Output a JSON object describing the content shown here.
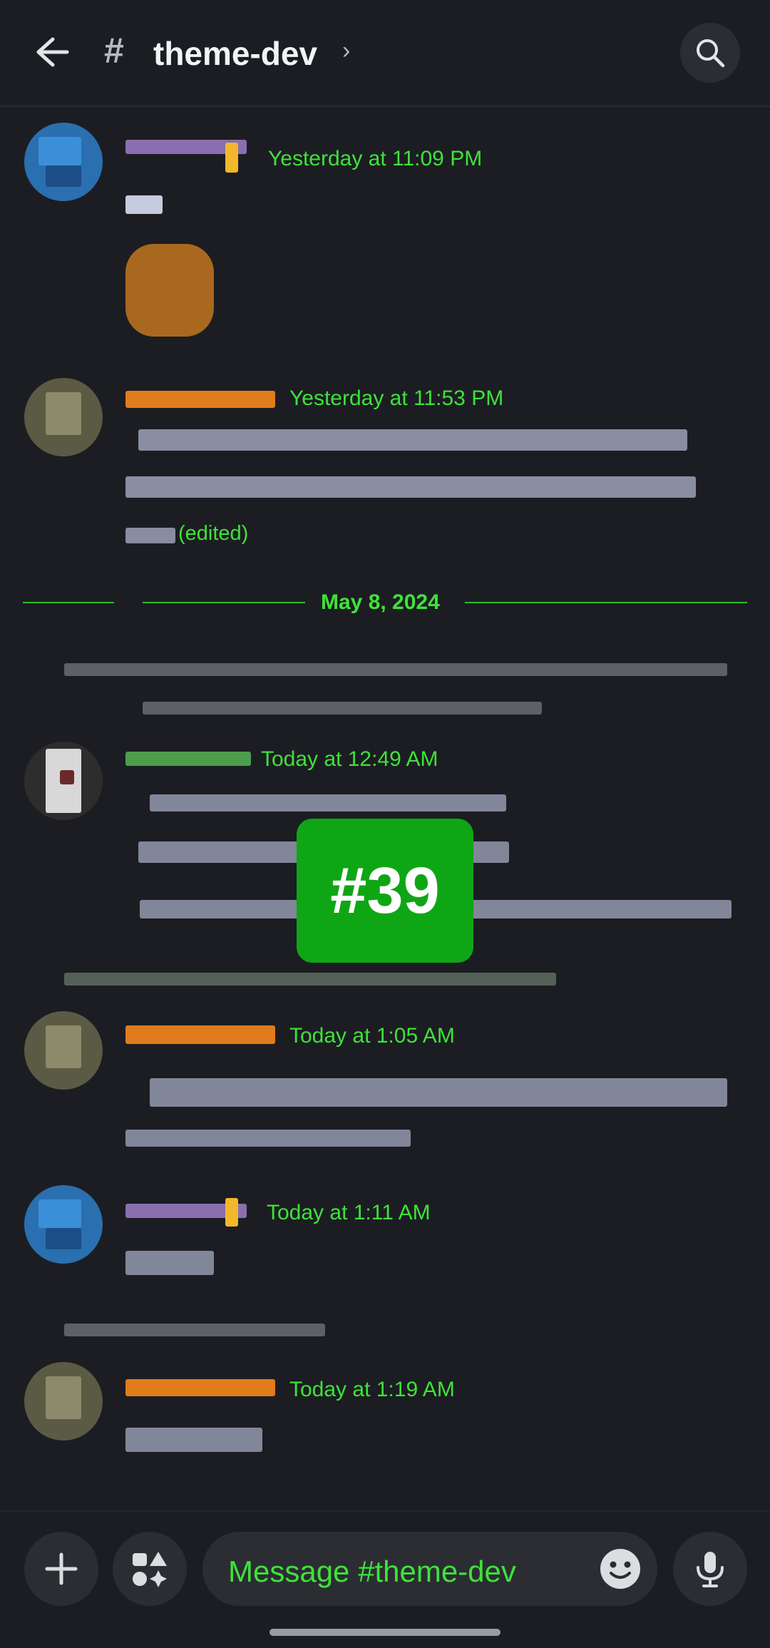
{
  "header": {
    "hash_symbol": "#",
    "channel_name": "theme-dev",
    "chevron": "›",
    "icons": {
      "back": "arrow-left-icon",
      "search": "search-icon"
    }
  },
  "messages": [
    {
      "timestamp": "Yesterday at 11:09 PM"
    },
    {
      "timestamp": "Yesterday at 11:53 PM",
      "edited": "(edited)"
    },
    {
      "timestamp": "Today at 12:49 AM"
    },
    {
      "timestamp": "Today at 1:05 AM"
    },
    {
      "timestamp": "Today at 1:11 AM"
    },
    {
      "timestamp": "Today at 1:19 AM"
    }
  ],
  "date_separator": "May 8, 2024",
  "badge": "#39",
  "composer": {
    "placeholder": "Message #theme-dev",
    "icons": {
      "add": "plus-icon",
      "apps": "apps-icon",
      "emoji": "emoji-icon",
      "voice": "microphone-icon"
    }
  },
  "colors": {
    "background": "#1c1d22",
    "accent_green": "#3fe23a",
    "badge_green": "#0fa615"
  }
}
